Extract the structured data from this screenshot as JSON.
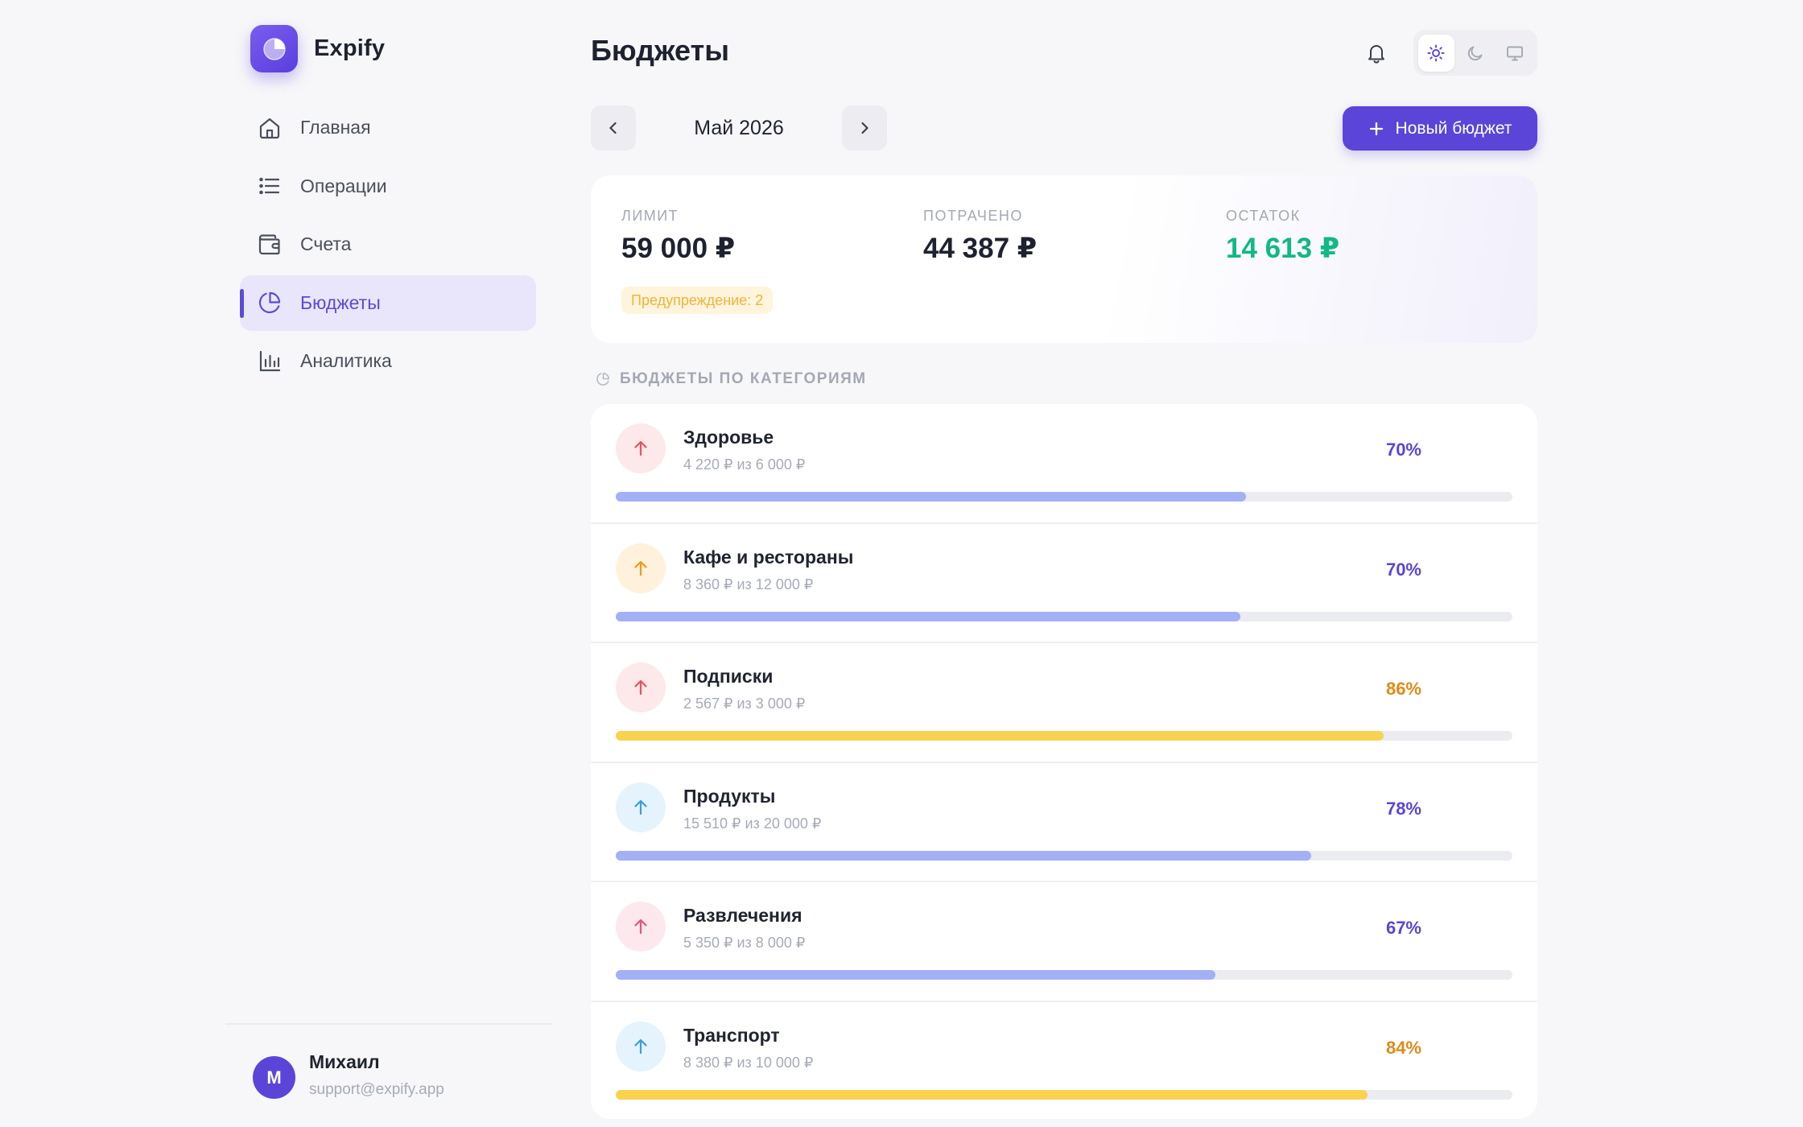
{
  "app": {
    "name": "Expify"
  },
  "sidebar": {
    "items": [
      {
        "label": "Главная",
        "icon": "home-icon",
        "active": false
      },
      {
        "label": "Операции",
        "icon": "list-icon",
        "active": false
      },
      {
        "label": "Счета",
        "icon": "wallet-icon",
        "active": false
      },
      {
        "label": "Бюджеты",
        "icon": "pie-chart-icon",
        "active": true
      },
      {
        "label": "Аналитика",
        "icon": "bar-chart-icon",
        "active": false
      }
    ],
    "user": {
      "initial": "М",
      "name": "Михаил",
      "email": "support@expify.app"
    }
  },
  "header": {
    "title": "Бюджеты",
    "theme_options": [
      "sun-icon",
      "moon-icon",
      "monitor-icon"
    ],
    "theme_selected": "sun-icon"
  },
  "toolbar": {
    "month": "Май 2026",
    "new_budget_label": "Новый бюджет"
  },
  "summary": {
    "limit_label": "ЛИМИТ",
    "limit_value": "59 000 ₽",
    "spent_label": "ПОТРАЧЕНО",
    "spent_value": "44 387 ₽",
    "remaining_label": "ОСТАТОК",
    "remaining_value": "14 613 ₽",
    "warning": "Предупреждение: 2"
  },
  "section": {
    "title": "БЮДЖЕТЫ ПО КАТЕГОРИЯМ"
  },
  "colors": {
    "accent": "#5b45d8",
    "bar_normal": "#a4b0f5",
    "bar_warning": "#f9d250",
    "pct_normal": "#5b45d8",
    "pct_warning": "#e08a17",
    "positive": "#12b886"
  },
  "budgets": [
    {
      "name": "Здоровье",
      "amount": "4 220 ₽ из 6 000 ₽",
      "pct": "70%",
      "fill": 0.703,
      "level": "normal",
      "icon_bg": "#fde8ea",
      "icon_color": "#e25563"
    },
    {
      "name": "Кафе и рестораны",
      "amount": "8 360 ₽ из 12 000 ₽",
      "pct": "70%",
      "fill": 0.697,
      "level": "normal",
      "icon_bg": "#fff1dc",
      "icon_color": "#ef9a1a"
    },
    {
      "name": "Подписки",
      "amount": "2 567 ₽ из 3 000 ₽",
      "pct": "86%",
      "fill": 0.856,
      "level": "warning",
      "icon_bg": "#fde8ea",
      "icon_color": "#e25563"
    },
    {
      "name": "Продукты",
      "amount": "15 510 ₽ из 20 000 ₽",
      "pct": "78%",
      "fill": 0.776,
      "level": "normal",
      "icon_bg": "#e5f3fc",
      "icon_color": "#3a9ee0"
    },
    {
      "name": "Развлечения",
      "amount": "5 350 ₽ из 8 000 ₽",
      "pct": "67%",
      "fill": 0.669,
      "level": "normal",
      "icon_bg": "#fde8ee",
      "icon_color": "#e2557a"
    },
    {
      "name": "Транспорт",
      "amount": "8 380 ₽ из 10 000 ₽",
      "pct": "84%",
      "fill": 0.838,
      "level": "warning",
      "icon_bg": "#e5f3fc",
      "icon_color": "#3a9ee0"
    }
  ]
}
